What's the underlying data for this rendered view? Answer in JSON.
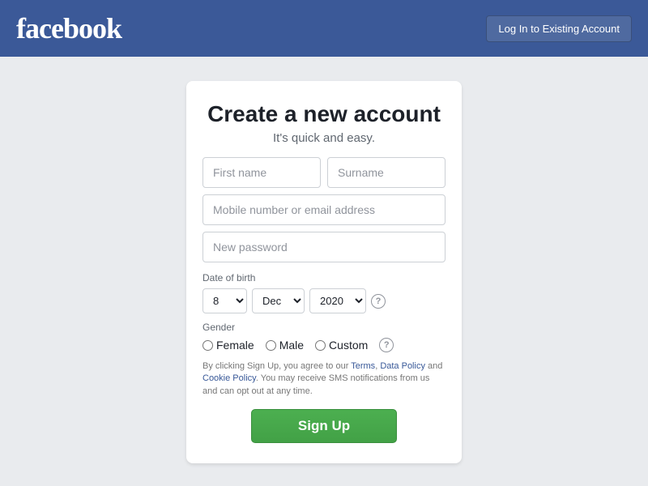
{
  "header": {
    "logo": "facebook",
    "login_button": "Log In to Existing Account"
  },
  "page": {
    "title": "Create a new account",
    "subtitle": "It's quick and easy."
  },
  "form": {
    "first_name_placeholder": "First name",
    "surname_placeholder": "Surname",
    "email_placeholder": "Mobile number or email address",
    "password_placeholder": "New password",
    "dob_label": "Date of birth",
    "dob_day_value": "8",
    "dob_month_value": "Dec",
    "dob_year_value": "2020",
    "gender_label": "Gender",
    "gender_options": [
      "Female",
      "Male",
      "Custom"
    ],
    "terms_text": "By clicking Sign Up, you agree to our Terms, Data Policy and Cookie Policy. You may receive SMS notifications from us and can opt out at any time.",
    "signup_button": "Sign Up"
  },
  "colors": {
    "header_bg": "#3b5998",
    "body_bg": "#e9ebee",
    "signup_btn_bg": "#4caf50"
  }
}
